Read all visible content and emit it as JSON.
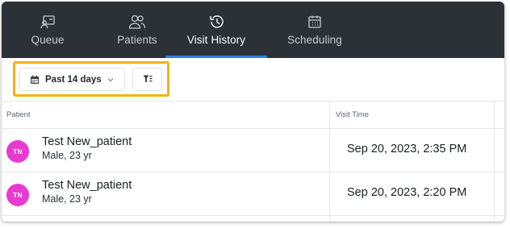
{
  "nav": {
    "tabs": [
      {
        "label": "Queue",
        "icon": "queue-icon"
      },
      {
        "label": "Patients",
        "icon": "patients-icon"
      },
      {
        "label": "Visit History",
        "icon": "history-icon"
      },
      {
        "label": "Scheduling",
        "icon": "calendar-icon"
      }
    ],
    "active_tab": "Visit History"
  },
  "filters": {
    "date_range": "Past 14 days",
    "date_icon": "calendar-icon",
    "filter_icon": "filter-icon"
  },
  "table": {
    "columns": [
      "Patient",
      "Visit Time"
    ],
    "rows": [
      {
        "initials": "TN",
        "name": "Test New_patient",
        "meta": "Male, 23 yr",
        "visit_time": "Sep 20, 2023, 2:35 PM"
      },
      {
        "initials": "TN",
        "name": "Test New_patient",
        "meta": "Male, 23 yr",
        "visit_time": "Sep 20, 2023, 2:20 PM"
      }
    ]
  },
  "colors": {
    "nav_bg": "#2b3137",
    "active_underline": "#2f7fe4",
    "highlight": "#f2b40f",
    "avatar": "#e83ad1"
  }
}
